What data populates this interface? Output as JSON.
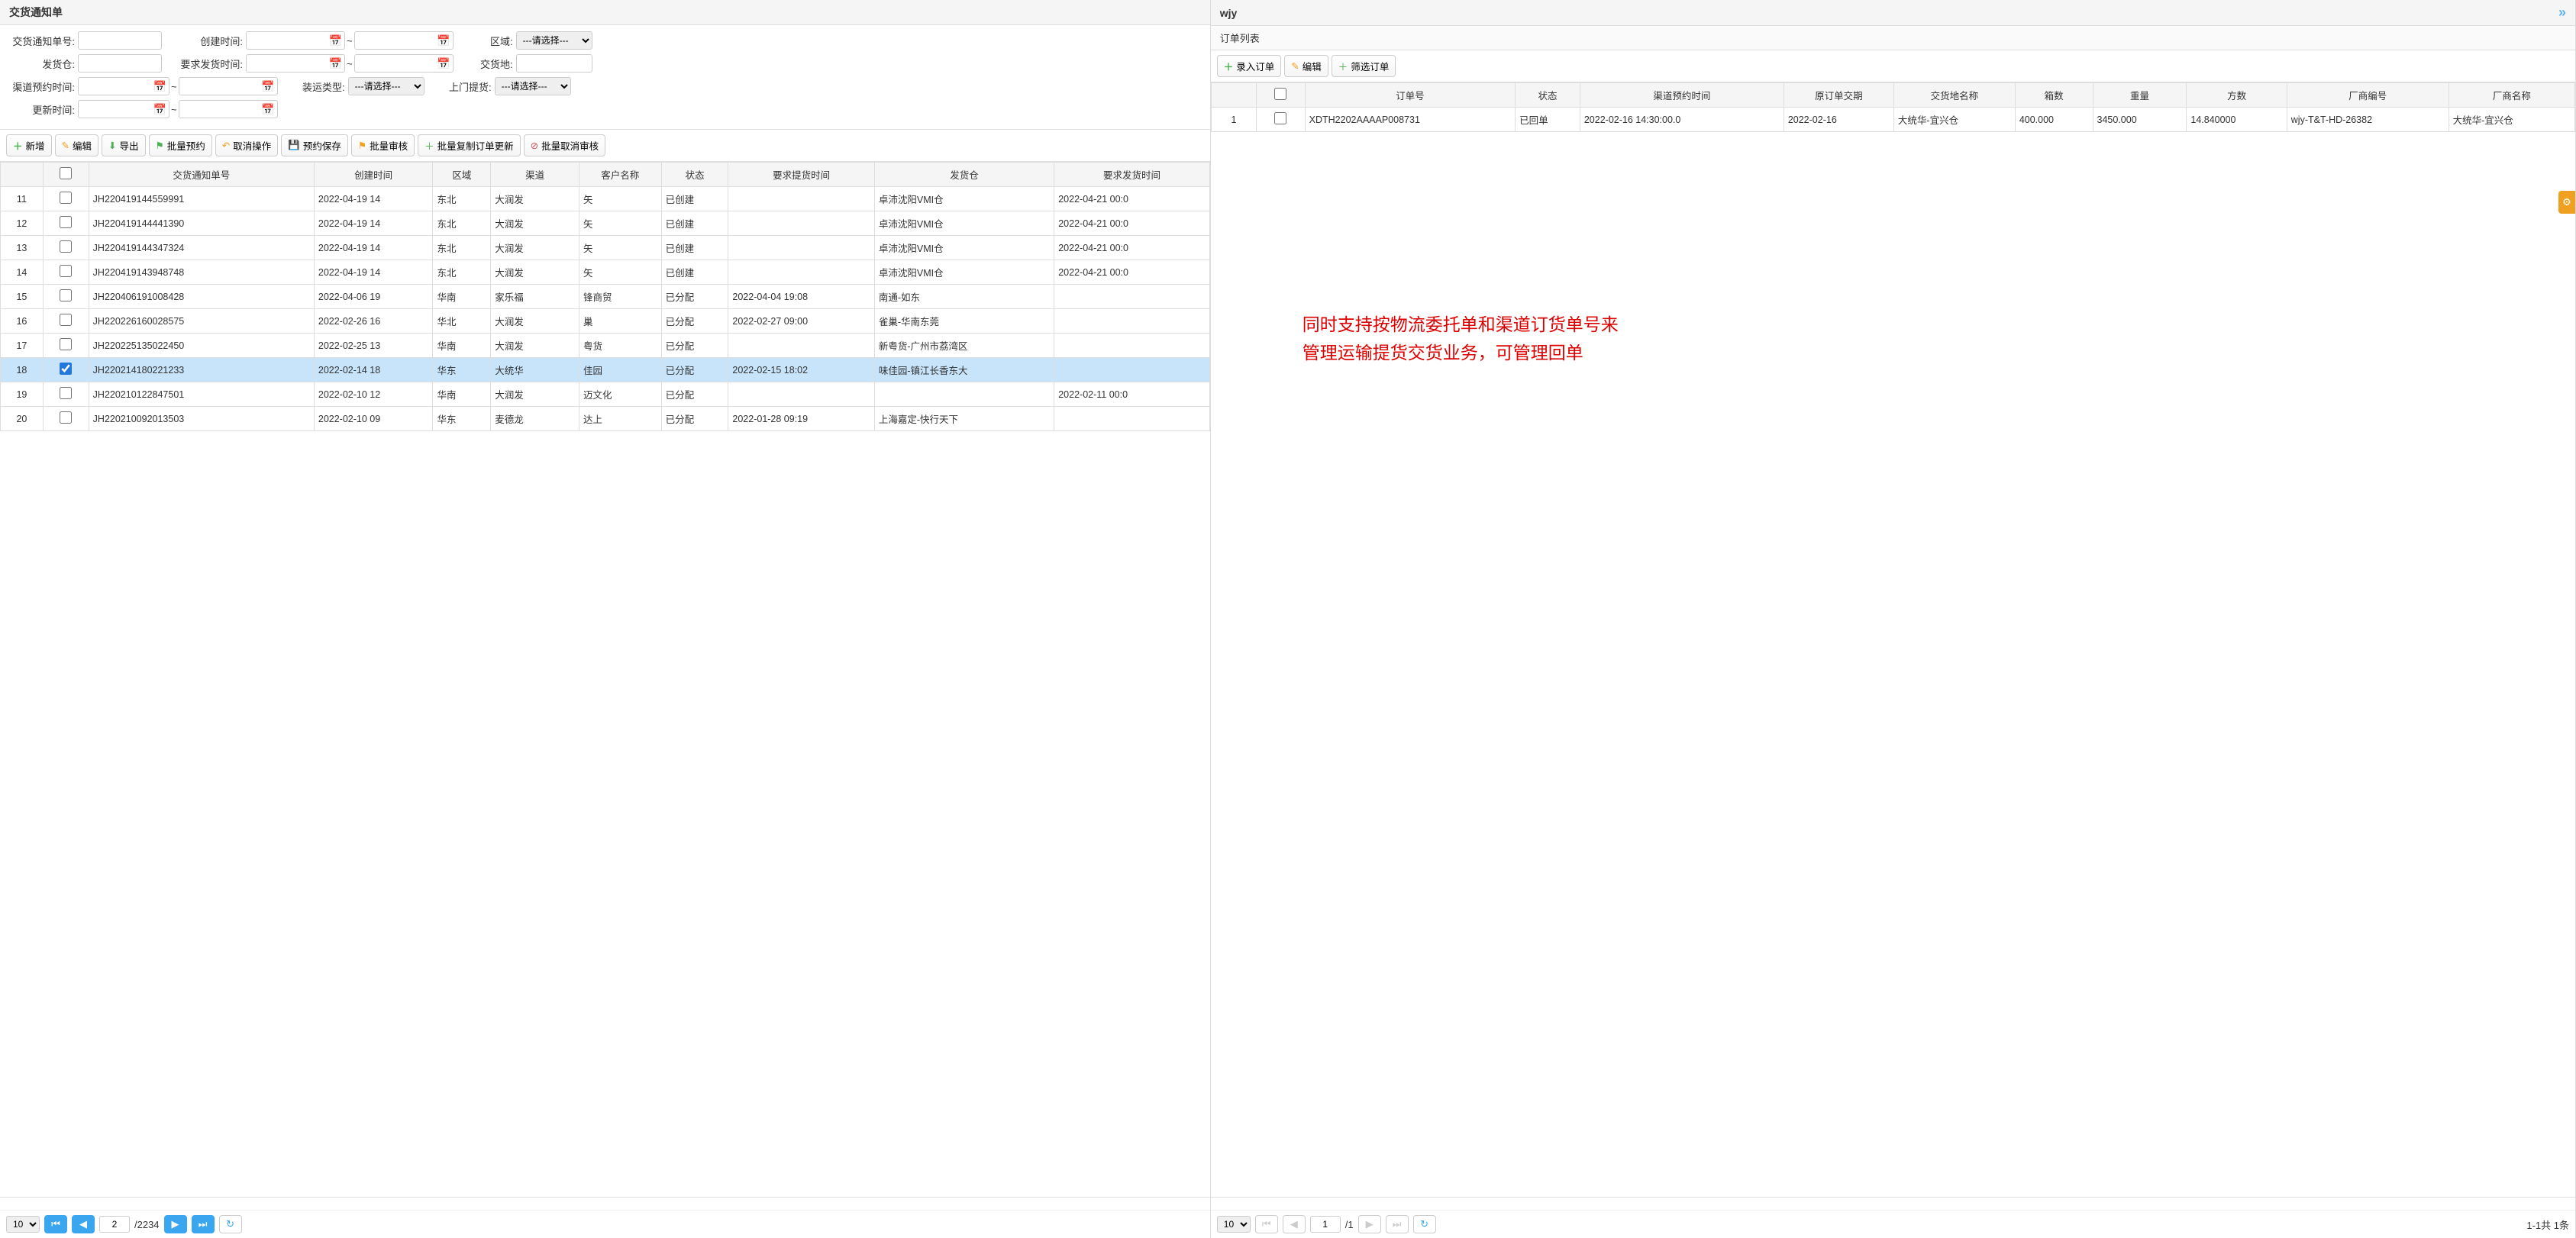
{
  "left": {
    "title": "交货通知单",
    "filters": {
      "notice_no_label": "交货通知单号:",
      "create_time_label": "创建时间:",
      "region_label": "区域:",
      "region_placeholder": "---请选择---",
      "warehouse_label": "发货仓:",
      "req_time_label": "要求发货时间:",
      "delivery_loc_label": "交货地:",
      "reserve_time_label": "渠道预约时间:",
      "load_type_label": "装运类型:",
      "load_type_placeholder": "---请选择---",
      "door_pickup_label": "上门提货:",
      "door_pickup_placeholder": "---请选择---",
      "update_time_label": "更新时间:"
    },
    "buttons": {
      "add": "新增",
      "edit": "编辑",
      "export": "导出",
      "batch_reserve": "批量预约",
      "cancel_op": "取消操作",
      "pre_save": "预约保存",
      "batch_review": "批量审核",
      "batch_copy": "批量复制订单更新",
      "batch_cancel": "批量取消审核"
    },
    "columns": [
      "",
      "",
      "交货通知单号",
      "创建时间",
      "区域",
      "渠道",
      "客户名称",
      "状态",
      "要求提货时间",
      "发货仓",
      "要求发货时间"
    ],
    "rows": [
      {
        "idx": "11",
        "sel": false,
        "no": "JH220419144559991",
        "ct": "2022-04-19 14",
        "reg": "东北",
        "ch": "大润发",
        "cust": "矢",
        "st": "已创建",
        "req": "",
        "wh": "卓沛沈阳VMI仓",
        "reqtime": "2022-04-21 00:0"
      },
      {
        "idx": "12",
        "sel": false,
        "no": "JH220419144441390",
        "ct": "2022-04-19 14",
        "reg": "东北",
        "ch": "大润发",
        "cust": "矢",
        "st": "已创建",
        "req": "",
        "wh": "卓沛沈阳VMI仓",
        "reqtime": "2022-04-21 00:0"
      },
      {
        "idx": "13",
        "sel": false,
        "no": "JH220419144347324",
        "ct": "2022-04-19 14",
        "reg": "东北",
        "ch": "大润发",
        "cust": "矢",
        "st": "已创建",
        "req": "",
        "wh": "卓沛沈阳VMI仓",
        "reqtime": "2022-04-21 00:0"
      },
      {
        "idx": "14",
        "sel": false,
        "no": "JH220419143948748",
        "ct": "2022-04-19 14",
        "reg": "东北",
        "ch": "大润发",
        "cust": "矢",
        "st": "已创建",
        "req": "",
        "wh": "卓沛沈阳VMI仓",
        "reqtime": "2022-04-21 00:0"
      },
      {
        "idx": "15",
        "sel": false,
        "no": "JH220406191008428",
        "ct": "2022-04-06 19",
        "reg": "华南",
        "ch": "家乐福",
        "cust": "锋商贸",
        "st": "已分配",
        "req": "2022-04-04 19:08",
        "wh": "南通-如东",
        "reqtime": ""
      },
      {
        "idx": "16",
        "sel": false,
        "no": "JH220226160028575",
        "ct": "2022-02-26 16",
        "reg": "华北",
        "ch": "大润发",
        "cust": "巢",
        "st": "已分配",
        "req": "2022-02-27 09:00",
        "wh": "雀巢-华南东莞",
        "reqtime": ""
      },
      {
        "idx": "17",
        "sel": false,
        "no": "JH220225135022450",
        "ct": "2022-02-25 13",
        "reg": "华南",
        "ch": "大润发",
        "cust": "粤货",
        "st": "已分配",
        "req": "",
        "wh": "新粤货-广州市荔湾区",
        "reqtime": ""
      },
      {
        "idx": "18",
        "sel": true,
        "no": "JH220214180221233",
        "ct": "2022-02-14 18",
        "reg": "华东",
        "ch": "大统华",
        "cust": "佳园",
        "st": "已分配",
        "req": "2022-02-15 18:02",
        "wh": "味佳园-镇江长香东大",
        "reqtime": ""
      },
      {
        "idx": "19",
        "sel": false,
        "no": "JH220210122847501",
        "ct": "2022-02-10 12",
        "reg": "华南",
        "ch": "大润发",
        "cust": "迈文化",
        "st": "已分配",
        "req": "",
        "wh": "",
        "reqtime": "2022-02-11 00:0"
      },
      {
        "idx": "20",
        "sel": false,
        "no": "JH220210092013503",
        "ct": "2022-02-10 09",
        "reg": "华东",
        "ch": "麦德龙",
        "cust": "达上",
        "st": "已分配",
        "req": "2022-01-28 09:19",
        "wh": "上海嘉定-快行天下",
        "reqtime": ""
      }
    ],
    "pager": {
      "size": "10",
      "page": "2",
      "total": "/2234"
    }
  },
  "right": {
    "title": "wjy",
    "subtitle": "订单列表",
    "buttons": {
      "enter": "录入订单",
      "edit": "编辑",
      "filter": "筛选订单"
    },
    "columns": [
      "",
      "",
      "订单号",
      "状态",
      "渠道预约时间",
      "原订单交期",
      "交货地名称",
      "箱数",
      "重量",
      "方数",
      "厂商编号",
      "厂商名称"
    ],
    "rows": [
      {
        "idx": "1",
        "sel": false,
        "ono": "XDTH2202AAAAP008731",
        "st": "已回单",
        "res": "2022-02-16 14:30:00.0",
        "odt": "2022-02-16",
        "loc": "大统华-宜兴仓",
        "box": "400.000",
        "wt": "3450.000",
        "vol": "14.840000",
        "ven": "wjy-T&T-HD-26382",
        "vname": "大统华-宜兴仓"
      }
    ],
    "pager": {
      "size": "10",
      "page": "1",
      "total": "/1",
      "info": "1-1共 1条"
    },
    "annotation": {
      "l1": "同时支持按物流委托单和渠道订货单号来",
      "l2": "管理运输提货交货业务，可管理回单"
    }
  }
}
